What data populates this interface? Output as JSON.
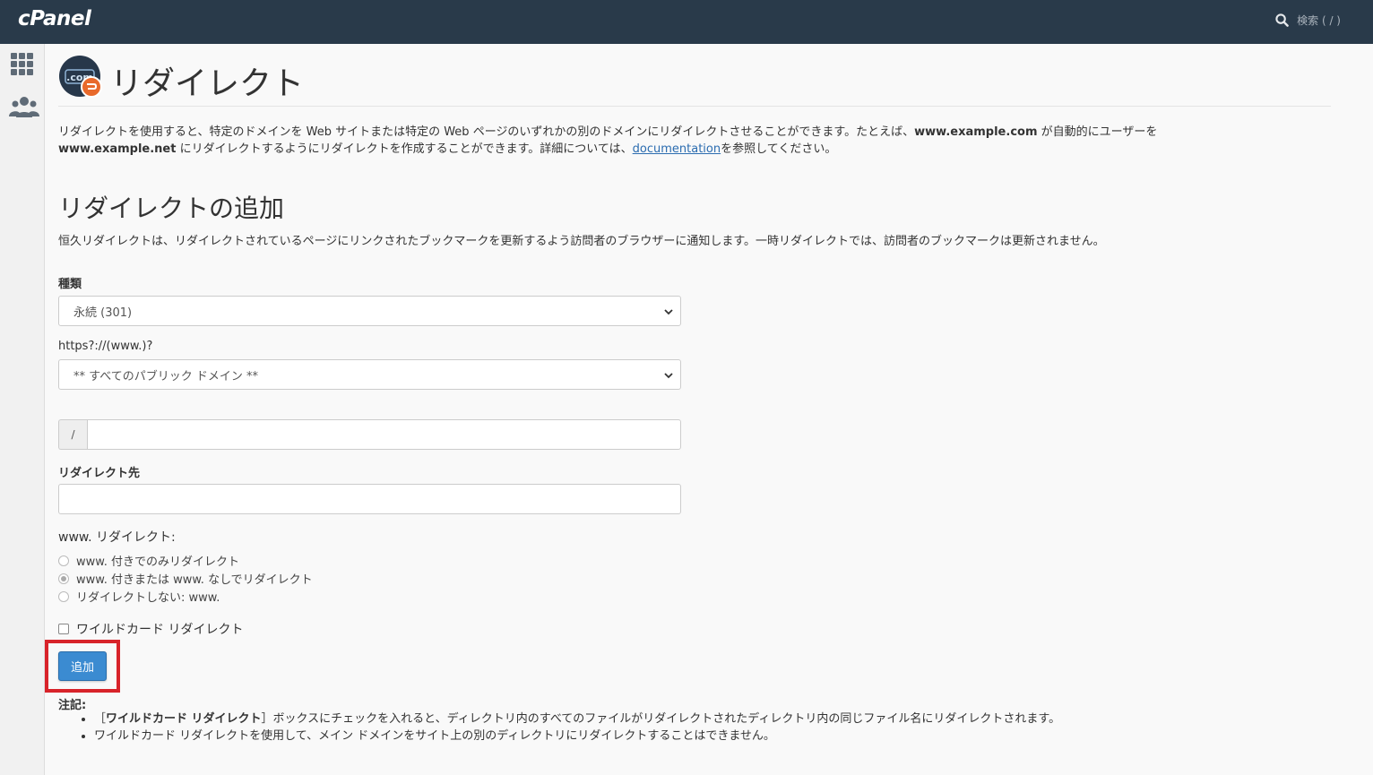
{
  "header": {
    "logo": "cPanel",
    "search_label": "検索 ( / )"
  },
  "sidebar": {
    "items": [
      {
        "name": "apps-grid-icon"
      },
      {
        "name": "users-icon"
      }
    ]
  },
  "page": {
    "title": "リダイレクト",
    "icon_text": ".com",
    "intro_part1": "リダイレクトを使用すると、特定のドメインを Web サイトまたは特定の Web ページのいずれかの別のドメインにリダイレクトさせることができます。たとえば、",
    "intro_bold1": "www.example.com",
    "intro_part2": " が自動的にユーザーを",
    "intro_bold2": "www.example.net",
    "intro_part3": " にリダイレクトするようにリダイレクトを作成することができます。詳細については、",
    "intro_link": "documentation",
    "intro_part4": "を参照してください。"
  },
  "add_section": {
    "title": "リダイレクトの追加",
    "description": "恒久リダイレクトは、リダイレクトされているページにリンクされたブックマークを更新するよう訪問者のブラウザーに通知します。一時リダイレクトでは、訪問者のブックマークは更新されません。"
  },
  "form": {
    "type_label": "種類",
    "type_value": "永続 (301)",
    "domain_label": "https?://(www.)?",
    "domain_value": "** すべてのパブリック ドメイン **",
    "path_prefix": "/",
    "path_value": "",
    "redirect_to_label": "リダイレクト先",
    "redirect_to_value": "",
    "www_label": "www. リダイレクト:",
    "www_options": [
      {
        "label": "www. 付きでのみリダイレクト",
        "selected": false
      },
      {
        "label": "www. 付きまたは www. なしでリダイレクト",
        "selected": true
      },
      {
        "label": "リダイレクトしない: www.",
        "selected": false
      }
    ],
    "wildcard_label": "ワイルドカード リダイレクト",
    "wildcard_checked": false,
    "add_button": "追加"
  },
  "notes": {
    "title": "注記:",
    "item1_open": "［",
    "item1_bold": "ワイルドカード リダイレクト",
    "item1_rest": "］ボックスにチェックを入れると、ディレクトリ内のすべてのファイルがリダイレクトされたディレクトリ内の同じファイル名にリダイレクトされます。",
    "item2": "ワイルドカード リダイレクトを使用して、メイン ドメインをサイト上の別のディレクトリにリダイレクトすることはできません。"
  },
  "colors": {
    "topbar": "#293a4a",
    "button": "#3b8bd1",
    "highlight": "#d8232a",
    "link": "#2b6cb0"
  }
}
